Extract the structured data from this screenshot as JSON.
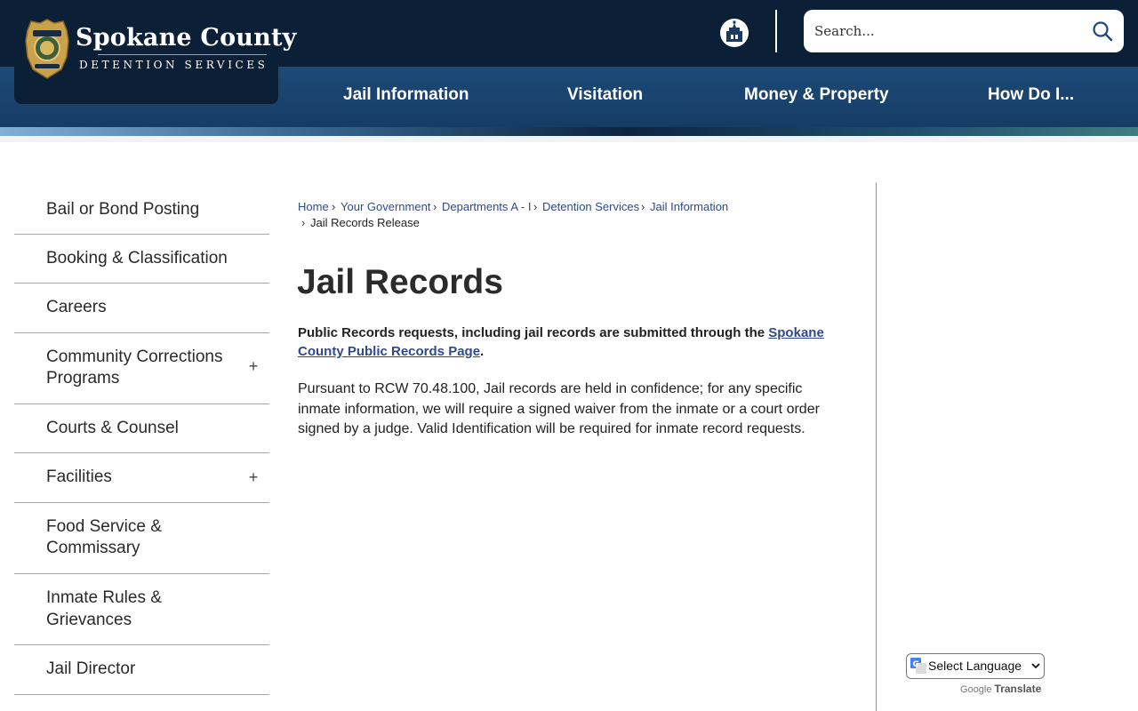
{
  "header": {
    "logo_title": "Spokane County",
    "logo_subtitle": "DETENTION SERVICES",
    "search_placeholder": "Search..."
  },
  "nav": [
    {
      "label": "Jail Information"
    },
    {
      "label": "Visitation"
    },
    {
      "label": "Money & Property"
    },
    {
      "label": "How Do I..."
    }
  ],
  "sidebar": {
    "items": [
      {
        "label": "Bail or Bond Posting"
      },
      {
        "label": "Booking & Classification"
      },
      {
        "label": "Careers"
      },
      {
        "label": "Community Corrections Programs",
        "line1": "Community Corrections",
        "line2": "Programs",
        "expandable": true
      },
      {
        "label": "Courts & Counsel"
      },
      {
        "label": "Facilities",
        "expandable": true
      },
      {
        "label": "Food Service & Commissary",
        "line1": "Food Service &",
        "line2": "Commissary"
      },
      {
        "label": "Inmate Rules & Grievances",
        "line1": "Inmate Rules &",
        "line2": "Grievances"
      },
      {
        "label": "Jail Director"
      }
    ],
    "expand_symbol": "+"
  },
  "breadcrumb": {
    "items": [
      "Home",
      "Your Government",
      "Departments A - I",
      "Detention Services",
      "Jail Information"
    ],
    "current": "Jail Records Release",
    "separator": "›"
  },
  "main": {
    "title": "Jail Records",
    "lead_text": "Public Records requests, including jail records are submitted through the ",
    "lead_link": "Spokane County Public Records Page",
    "lead_end": ".",
    "body": "Pursuant to RCW 70.48.100, Jail records are held in confidence; for any specific inmate information, we will require a signed waiver from the inmate or a court order signed by a judge. Valid Identification will be required for inmate record requests."
  },
  "translate": {
    "select_label": "Select Language",
    "powered_google": "Google",
    "powered_translate": "Translate"
  },
  "colors": {
    "top_bar": "#0b1f36",
    "nav_bar": "#1d4a78",
    "link": "#2f4a8a"
  }
}
